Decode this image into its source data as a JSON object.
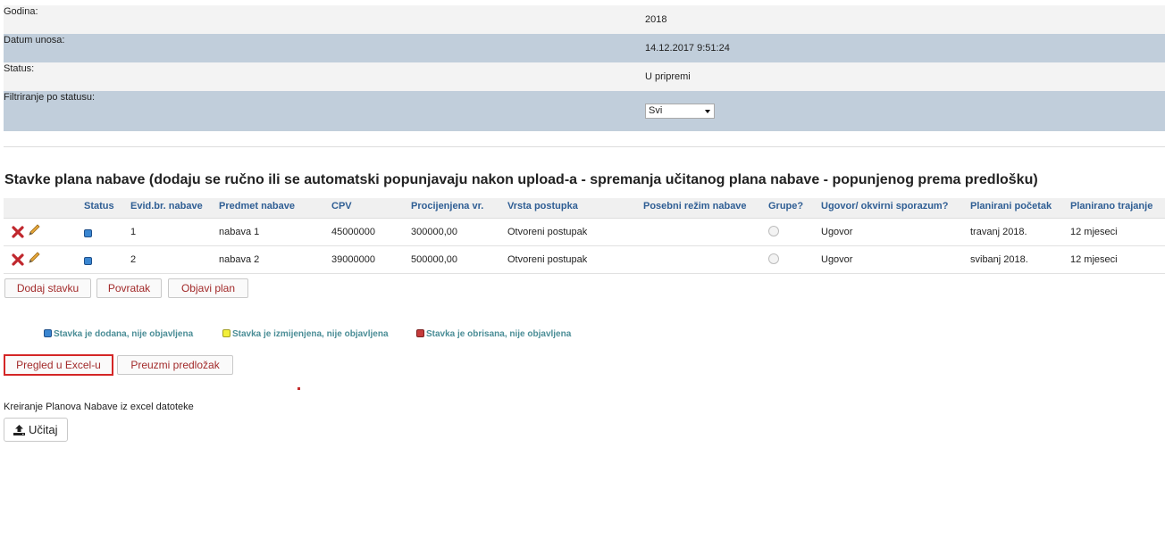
{
  "info": {
    "godina": {
      "label": "Godina:",
      "value": "2018"
    },
    "datum_unosa": {
      "label": "Datum unosa:",
      "value": "14.12.2017 9:51:24"
    },
    "status": {
      "label": "Status:",
      "value": "U pripremi"
    },
    "filter": {
      "label": "Filtriranje po statusu:",
      "selected": "Svi"
    }
  },
  "section_title": "Stavke plana nabave (dodaju se ručno ili se automatski popunjavaju nakon upload-a - spremanja učitanog plana nabave - popunjenog prema predlošku)",
  "table": {
    "headers": [
      "Status",
      "Evid.br. nabave",
      "Predmet nabave",
      "CPV",
      "Procijenjena vr.",
      "Vrsta postupka",
      "Posebni režim nabave",
      "Grupe?",
      "Ugovor/ okvirni sporazum?",
      "Planirani početak",
      "Planirano trajanje"
    ],
    "rows": [
      {
        "evid": "1",
        "predmet": "nabava 1",
        "cpv": "45000000",
        "vrijednost": "300000,00",
        "postupak": "Otvoreni postupak",
        "rezim": "",
        "ugovor": "Ugovor",
        "pocetak": "travanj 2018.",
        "trajanje": "12 mjeseci",
        "status_color": "#3a86d1"
      },
      {
        "evid": "2",
        "predmet": "nabava 2",
        "cpv": "39000000",
        "vrijednost": "500000,00",
        "postupak": "Otvoreni postupak",
        "rezim": "",
        "ugovor": "Ugovor",
        "pocetak": "svibanj 2018.",
        "trajanje": "12 mjeseci",
        "status_color": "#3a86d1"
      }
    ]
  },
  "buttons": {
    "dodaj": "Dodaj stavku",
    "povratak": "Povratak",
    "objavi": "Objavi plan",
    "excel": "Pregled u Excel-u",
    "predlozak": "Preuzmi predložak",
    "ucitaj": "Učitaj"
  },
  "legend": {
    "added": "Stavka je dodana, nije objavljena",
    "changed": "Stavka je izmijenjena, nije objavljena",
    "deleted": "Stavka je obrisana, nije objavljena"
  },
  "import_label": "Kreiranje Planova Nabave iz excel datoteke",
  "colors": {
    "added": "#3a86d1",
    "changed": "#f2ef3a",
    "deleted": "#c53b3b",
    "header_text": "#2f5e94",
    "button_text": "#a22a2a"
  }
}
